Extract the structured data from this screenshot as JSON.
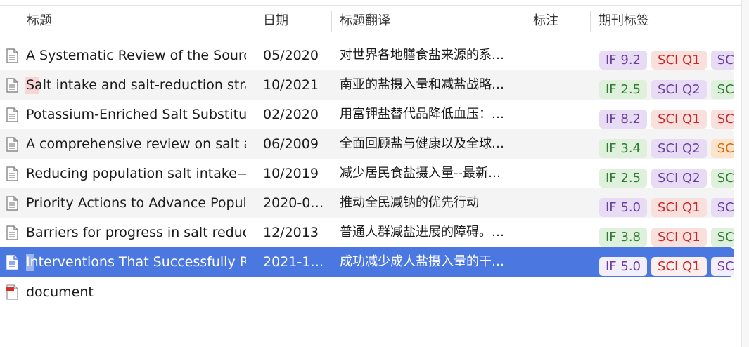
{
  "columns": [
    "标题",
    "日期",
    "标题翻译",
    "标注",
    "期刊标签"
  ],
  "rows": [
    {
      "title": "A Systematic Review of the Source",
      "date": "05/2020",
      "translation": "对世界各地膳食盐来源的系…",
      "tags": [
        {
          "label": "IF 9.2",
          "style": "if-purple"
        },
        {
          "label": "SCI Q1",
          "style": "q1"
        },
        {
          "label": "SCI",
          "style": "sci-purple"
        }
      ]
    },
    {
      "title": "Salt intake and salt-reduction strategies",
      "date": "10/2021",
      "translation": "南亚的盐摄入量和减盐战略…",
      "tags": [
        {
          "label": "IF 2.5",
          "style": "if-green"
        },
        {
          "label": "SCI Q2",
          "style": "q2"
        },
        {
          "label": "SCI",
          "style": "sci-green"
        }
      ]
    },
    {
      "title": "Potassium-Enriched Salt Substitutes",
      "date": "02/2020",
      "translation": "用富钾盐替代品降低血压：…",
      "tags": [
        {
          "label": "IF 8.2",
          "style": "if-purple"
        },
        {
          "label": "SCI Q1",
          "style": "q1"
        },
        {
          "label": "SCI",
          "style": "sci-red"
        }
      ]
    },
    {
      "title": "A comprehensive review on salt and",
      "date": "06/2009",
      "translation": "全面回顾盐与健康以及全球…",
      "tags": [
        {
          "label": "IF 3.4",
          "style": "if-green"
        },
        {
          "label": "SCI Q2",
          "style": "q2"
        },
        {
          "label": "SCI",
          "style": "sci-orange"
        }
      ]
    },
    {
      "title": "Reducing population salt intake—",
      "date": "10/2019",
      "translation": "减少居民食盐摄入量--最新…",
      "tags": [
        {
          "label": "IF 2.5",
          "style": "if-green"
        },
        {
          "label": "SCI Q2",
          "style": "q2"
        },
        {
          "label": "SCI",
          "style": "sci-green"
        }
      ]
    },
    {
      "title": "Priority Actions to Advance Population",
      "date": "2020-0…",
      "translation": "推动全民减钠的优先行动",
      "tags": [
        {
          "label": "IF 5.0",
          "style": "if-purple"
        },
        {
          "label": "SCI Q1",
          "style": "q1"
        },
        {
          "label": "SCI",
          "style": "sci-purple"
        }
      ]
    },
    {
      "title": "Barriers for progress in salt reduction",
      "date": "12/2013",
      "translation": "普通人群减盐进展的障碍。…",
      "tags": [
        {
          "label": "IF 3.8",
          "style": "if-green"
        },
        {
          "label": "SCI Q1",
          "style": "q1"
        },
        {
          "label": "SCI",
          "style": "sci-green"
        }
      ]
    },
    {
      "title": "Interventions That Successfully Reduce",
      "date": "2021-1…",
      "translation": "成功减少成人盐摄入量的干…",
      "tags": [
        {
          "label": "IF 5.0",
          "style": "if-purple"
        },
        {
          "label": "SCI Q1",
          "style": "q1"
        },
        {
          "label": "SCI",
          "style": "sci-purple"
        }
      ]
    }
  ],
  "attachment": {
    "label": "document"
  }
}
